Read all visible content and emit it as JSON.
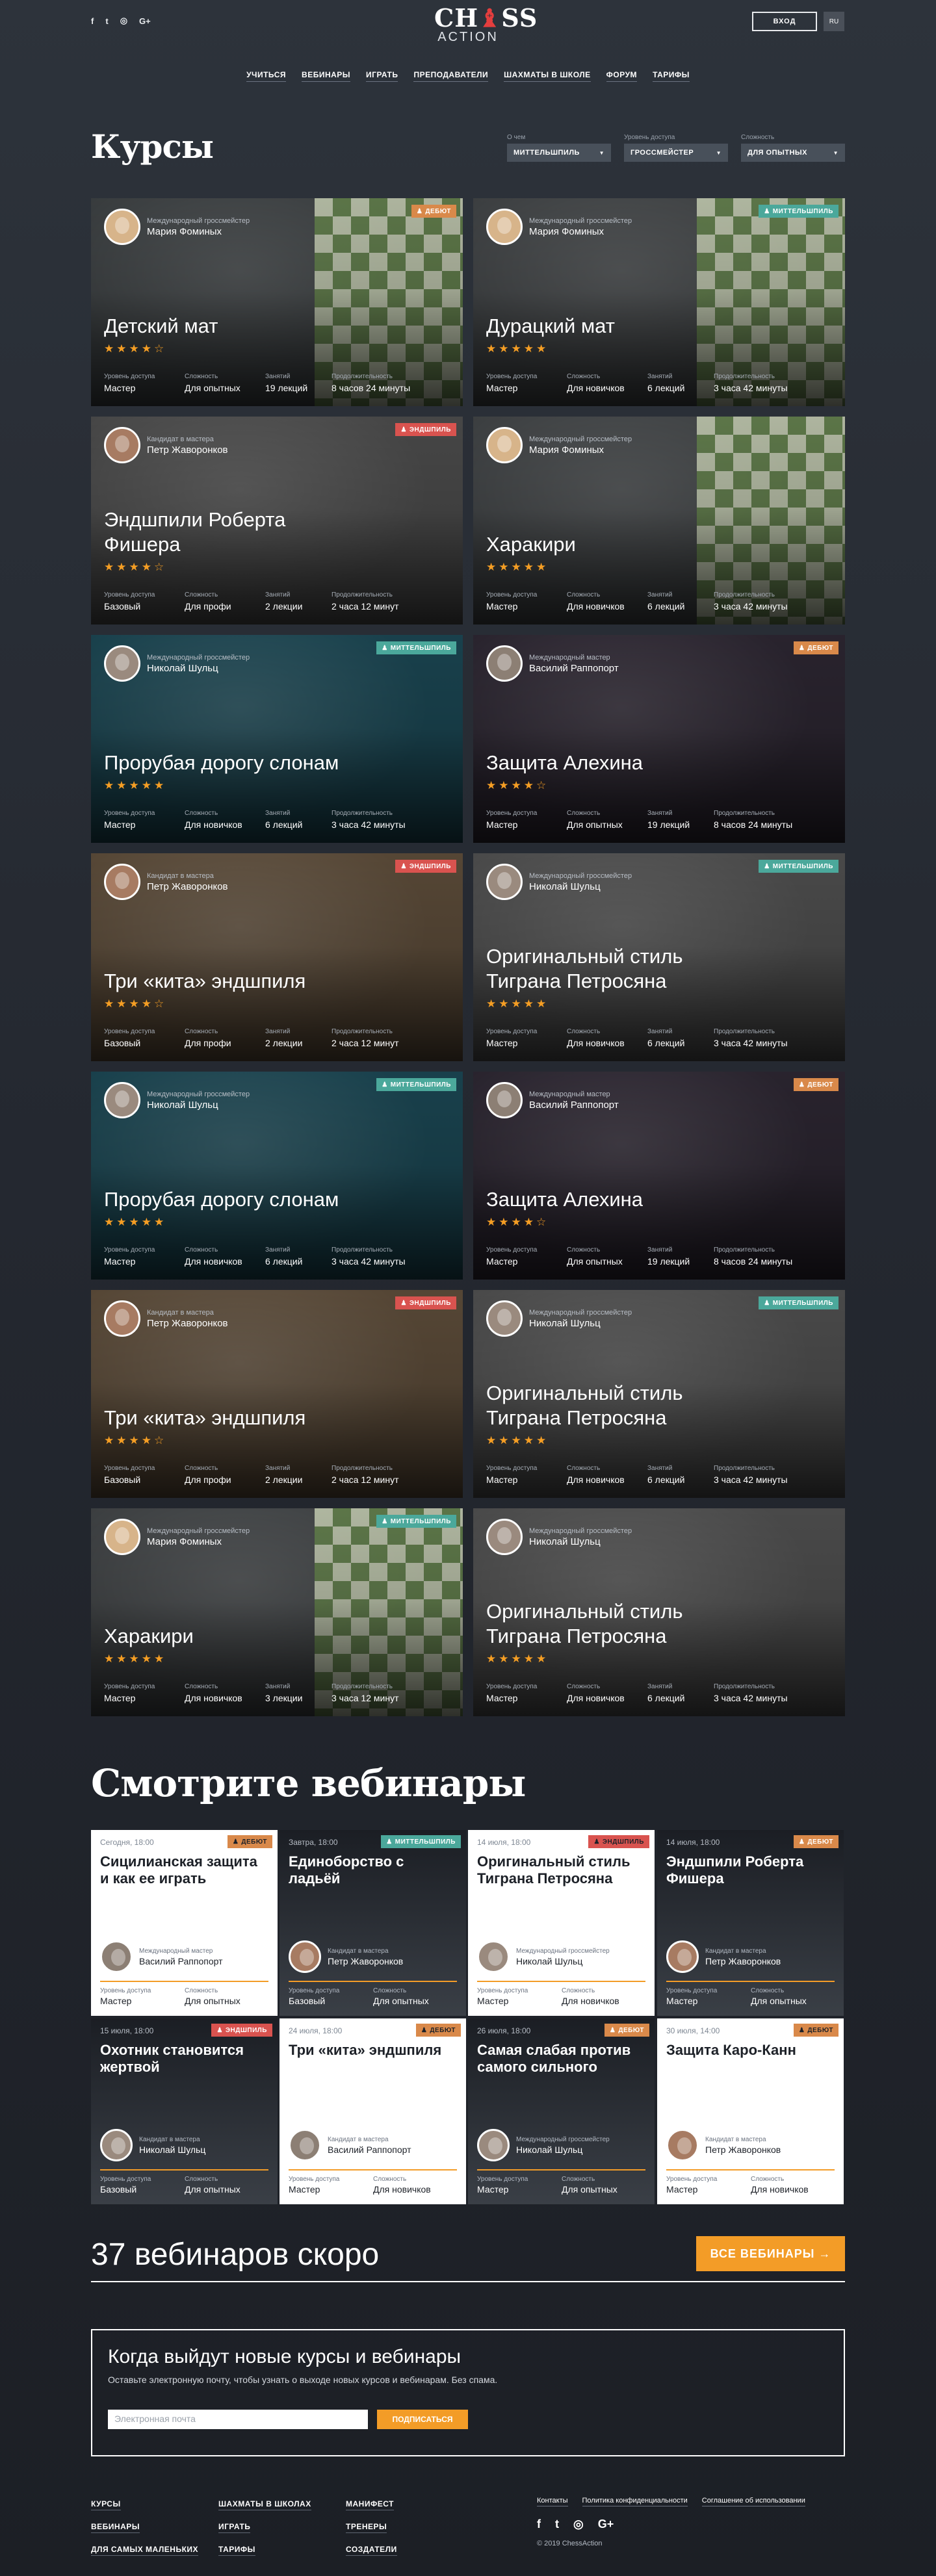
{
  "header": {
    "social": [
      "f",
      "t",
      "◎",
      "G+"
    ],
    "logo_top_a": "CH",
    "logo_top_b": "♝",
    "logo_top_c": "SS",
    "logo_bottom": "ACTION",
    "login": "ВХОД",
    "lang": "RU",
    "nav": [
      "Учиться",
      "Вебинары",
      "Играть",
      "Преподаватели",
      "Шахматы в школе",
      "Форум",
      "Тарифы"
    ]
  },
  "courses": {
    "title": "Курсы",
    "filters": [
      {
        "label": "О чем",
        "value": "Миттельшпиль"
      },
      {
        "label": "Уровень доступа",
        "value": "Гроссмейстер"
      },
      {
        "label": "Сложность",
        "value": "Для опытных"
      }
    ],
    "meta_keys": {
      "access": "Уровень доступа",
      "level": "Сложность",
      "lessons": "Занятий",
      "duration": "Продолжительность"
    },
    "items": [
      {
        "role": "Международный гроссмейстер",
        "author": "Мария Фоминых",
        "badge": "Дебют",
        "badge_kind": "d",
        "title": "Детский мат",
        "stars": "★★★★☆",
        "access": "Мастер",
        "level": "Для опытных",
        "lessons": "19 лекций",
        "duration": "8 часов 24 минуты",
        "bg": "#3b3f41",
        "avatar": "#d7b48a",
        "board": true
      },
      {
        "role": "Международный гроссмейстер",
        "author": "Мария Фоминых",
        "badge": "Миттельшпиль",
        "badge_kind": "m",
        "title": "Дурацкий мат",
        "stars": "★★★★★",
        "access": "Мастер",
        "level": "Для новичков",
        "lessons": "6 лекций",
        "duration": "3 часа 42 минуты",
        "bg": "#3f4244",
        "avatar": "#d7b48a",
        "board": true
      },
      {
        "role": "Кандидат в мастера",
        "author": "Петр Жаворонков",
        "badge": "Эндшпиль",
        "badge_kind": "e",
        "title": "Эндшпили Роберта Фишера",
        "stars": "★★★★☆",
        "access": "Базовый",
        "level": "Для профи",
        "lessons": "2 лекции",
        "duration": "2 часа 12 минут",
        "bg": "#4a4a4a",
        "avatar": "#a77b62",
        "board": false
      },
      {
        "role": "Международный гроссмейстер",
        "author": "Мария Фоминых",
        "badge": "",
        "badge_kind": "",
        "title": "Харакири",
        "stars": "★★★★★",
        "access": "Мастер",
        "level": "Для новичков",
        "lessons": "6 лекций",
        "duration": "3 часа 42 минуты",
        "bg": "#3f4244",
        "avatar": "#d7b48a",
        "board": true
      },
      {
        "role": "Международный гроссмейстер",
        "author": "Николай Шульц",
        "badge": "Миттельшпиль",
        "badge_kind": "m",
        "title": "Прорубая дорогу слонам",
        "stars": "★★★★★",
        "access": "Мастер",
        "level": "Для новичков",
        "lessons": "6 лекций",
        "duration": "3 часа 42 минуты",
        "bg": "#1a4450",
        "avatar": "#9a8a7e",
        "board": false
      },
      {
        "role": "Международный мастер",
        "author": "Василий Раппопорт",
        "badge": "Дебют",
        "badge_kind": "d",
        "title": "Защита Алехина",
        "stars": "★★★★☆",
        "access": "Мастер",
        "level": "Для опытных",
        "lessons": "19 лекций",
        "duration": "8 часов 24 минуты",
        "bg": "#2b2530",
        "avatar": "#8c7f74",
        "board": false
      },
      {
        "role": "Кандидат в мастера",
        "author": "Петр Жаворонков",
        "badge": "Эндшпиль",
        "badge_kind": "e",
        "title": "Три «кита» эндшпиля",
        "stars": "★★★★☆",
        "access": "Базовый",
        "level": "Для профи",
        "lessons": "2 лекции",
        "duration": "2 часа 12 минут",
        "bg": "#5a4a38",
        "avatar": "#a77b62",
        "board": false
      },
      {
        "role": "Международный гроссмейстер",
        "author": "Николай Шульц",
        "badge": "Миттельшпиль",
        "badge_kind": "m",
        "title": "Оригинальный стиль Тиграна Петросяна",
        "stars": "★★★★★",
        "access": "Мастер",
        "level": "Для новичков",
        "lessons": "6 лекций",
        "duration": "3 часа 42 минуты",
        "bg": "#4d4d4d",
        "avatar": "#9a8a7e",
        "board": false
      },
      {
        "role": "Международный гроссмейстер",
        "author": "Николай Шульц",
        "badge": "Миттельшпиль",
        "badge_kind": "m",
        "title": "Прорубая дорогу слонам",
        "stars": "★★★★★",
        "access": "Мастер",
        "level": "Для новичков",
        "lessons": "6 лекций",
        "duration": "3 часа 42 минуты",
        "bg": "#1a4450",
        "avatar": "#9a8a7e",
        "board": false
      },
      {
        "role": "Международный мастер",
        "author": "Василий Раппопорт",
        "badge": "Дебют",
        "badge_kind": "d",
        "title": "Защита Алехина",
        "stars": "★★★★☆",
        "access": "Мастер",
        "level": "Для опытных",
        "lessons": "19 лекций",
        "duration": "8 часов 24 минуты",
        "bg": "#2b2530",
        "avatar": "#8c7f74",
        "board": false
      },
      {
        "role": "Кандидат в мастера",
        "author": "Петр Жаворонков",
        "badge": "Эндшпиль",
        "badge_kind": "e",
        "title": "Три «кита» эндшпиля",
        "stars": "★★★★☆",
        "access": "Базовый",
        "level": "Для профи",
        "lessons": "2 лекции",
        "duration": "2 часа 12 минут",
        "bg": "#5a4a38",
        "avatar": "#a77b62",
        "board": false
      },
      {
        "role": "Международный гроссмейстер",
        "author": "Николай Шульц",
        "badge": "Миттельшпиль",
        "badge_kind": "m",
        "title": "Оригинальный стиль Тиграна Петросяна",
        "stars": "★★★★★",
        "access": "Мастер",
        "level": "Для новичков",
        "lessons": "6 лекций",
        "duration": "3 часа 42 минуты",
        "bg": "#4d4d4d",
        "avatar": "#9a8a7e",
        "board": false
      },
      {
        "role": "Международный гроссмейстер",
        "author": "Мария Фоминых",
        "badge": "Миттельшпиль",
        "badge_kind": "m",
        "title": "Харакири",
        "stars": "★★★★★",
        "access": "Мастер",
        "level": "Для новичков",
        "lessons": "3 лекции",
        "duration": "3 часа 12 минут",
        "bg": "#3f4244",
        "avatar": "#d7b48a",
        "board": true
      },
      {
        "role": "Международный гроссмейстер",
        "author": "Николай Шульц",
        "badge": "",
        "badge_kind": "",
        "title": "Оригинальный стиль Тиграна Петросяна",
        "stars": "★★★★★",
        "access": "Мастер",
        "level": "Для новичков",
        "lessons": "6 лекций",
        "duration": "3 часа 42 минуты",
        "bg": "#4d4d4d",
        "avatar": "#9a8a7e",
        "board": false
      }
    ]
  },
  "webinars": {
    "title": "Смотрите вебинары",
    "meta_keys": {
      "access": "Уровень доступа",
      "level": "Сложность"
    },
    "items": [
      {
        "date": "Сегодня, 18:00",
        "badge": "Дебют",
        "badge_kind": "d",
        "title": "Сицилианская защита и как ее играть",
        "role": "Международный мастер",
        "author": "Василий Раппопорт",
        "access": "Мастер",
        "level": "Для опытных",
        "theme": "white",
        "avatar": "#8c7f74"
      },
      {
        "date": "Завтра, 18:00",
        "badge": "Миттельшпиль",
        "badge_kind": "m",
        "title": "Единоборство с ладьёй",
        "role": "Кандидат в мастера",
        "author": "Петр Жаворонков",
        "access": "Базовый",
        "level": "Для опытных",
        "theme": "dark",
        "avatar": "#a77b62"
      },
      {
        "date": "14 июля, 18:00",
        "badge": "Эндшпиль",
        "badge_kind": "e",
        "title": "Оригинальный стиль Тиграна Петросяна",
        "role": "Международный гроссмейстер",
        "author": "Николай Шульц",
        "access": "Мастер",
        "level": "Для новичков",
        "theme": "white",
        "avatar": "#9a8a7e"
      },
      {
        "date": "14 июля, 18:00",
        "badge": "Дебют",
        "badge_kind": "d",
        "title": "Эндшпили Роберта Фишера",
        "role": "Кандидат в мастера",
        "author": "Петр Жаворонков",
        "access": "Мастер",
        "level": "Для опытных",
        "theme": "dark",
        "avatar": "#a77b62"
      },
      {
        "date": "15 июля, 18:00",
        "badge": "Эндшпиль",
        "badge_kind": "e",
        "title": "Охотник становится жертвой",
        "role": "Кандидат в мастера",
        "author": "Николай Шульц",
        "access": "Базовый",
        "level": "Для опытных",
        "theme": "dark",
        "avatar": "#9a8a7e"
      },
      {
        "date": "24 июля, 18:00",
        "badge": "Дебют",
        "badge_kind": "d",
        "title": "Три «кита» эндшпиля",
        "role": "Кандидат в мастера",
        "author": "Василий Раппопорт",
        "access": "Мастер",
        "level": "Для новичков",
        "theme": "white",
        "avatar": "#8c7f74"
      },
      {
        "date": "26 июля, 18:00",
        "badge": "Дебют",
        "badge_kind": "d",
        "title": "Самая слабая против самого сильного",
        "role": "Международный гроссмейстер",
        "author": "Николай Шульц",
        "access": "Мастер",
        "level": "Для опытных",
        "theme": "dark",
        "avatar": "#9a8a7e"
      },
      {
        "date": "30 июля, 14:00",
        "badge": "Дебют",
        "badge_kind": "d",
        "title": "Защита Каро-Канн",
        "role": "Кандидат в мастера",
        "author": "Петр Жаворонков",
        "access": "Мастер",
        "level": "Для новичков",
        "theme": "white",
        "avatar": "#a77b62"
      }
    ],
    "soon": "37 вебинаров скоро",
    "all_button": "Все вебинары →"
  },
  "subscribe": {
    "title": "Когда выйдут новые курсы и вебинары",
    "text": "Оставьте электронную почту, чтобы узнать о выходе новых курсов и вебинарам. Без спама.",
    "placeholder": "Электронная почта",
    "button": "Подписаться"
  },
  "footer": {
    "col1": [
      "Курсы",
      "Вебинары",
      "Для самых маленьких"
    ],
    "col2": [
      "Шахматы в школах",
      "Играть",
      "Тарифы"
    ],
    "col3": [
      "Манифест",
      "Тренеры",
      "Создатели"
    ],
    "links": [
      "Контакты",
      "Политика конфиденциальности",
      "Соглашение об использовании"
    ],
    "social": [
      "f",
      "t",
      "◎",
      "G+"
    ],
    "copyright": "© 2019 ChessAction"
  },
  "colors": {
    "accent": "#f39c27",
    "debut": "#d9894a",
    "mittel": "#4ba89b",
    "endgame": "#d9534f"
  }
}
